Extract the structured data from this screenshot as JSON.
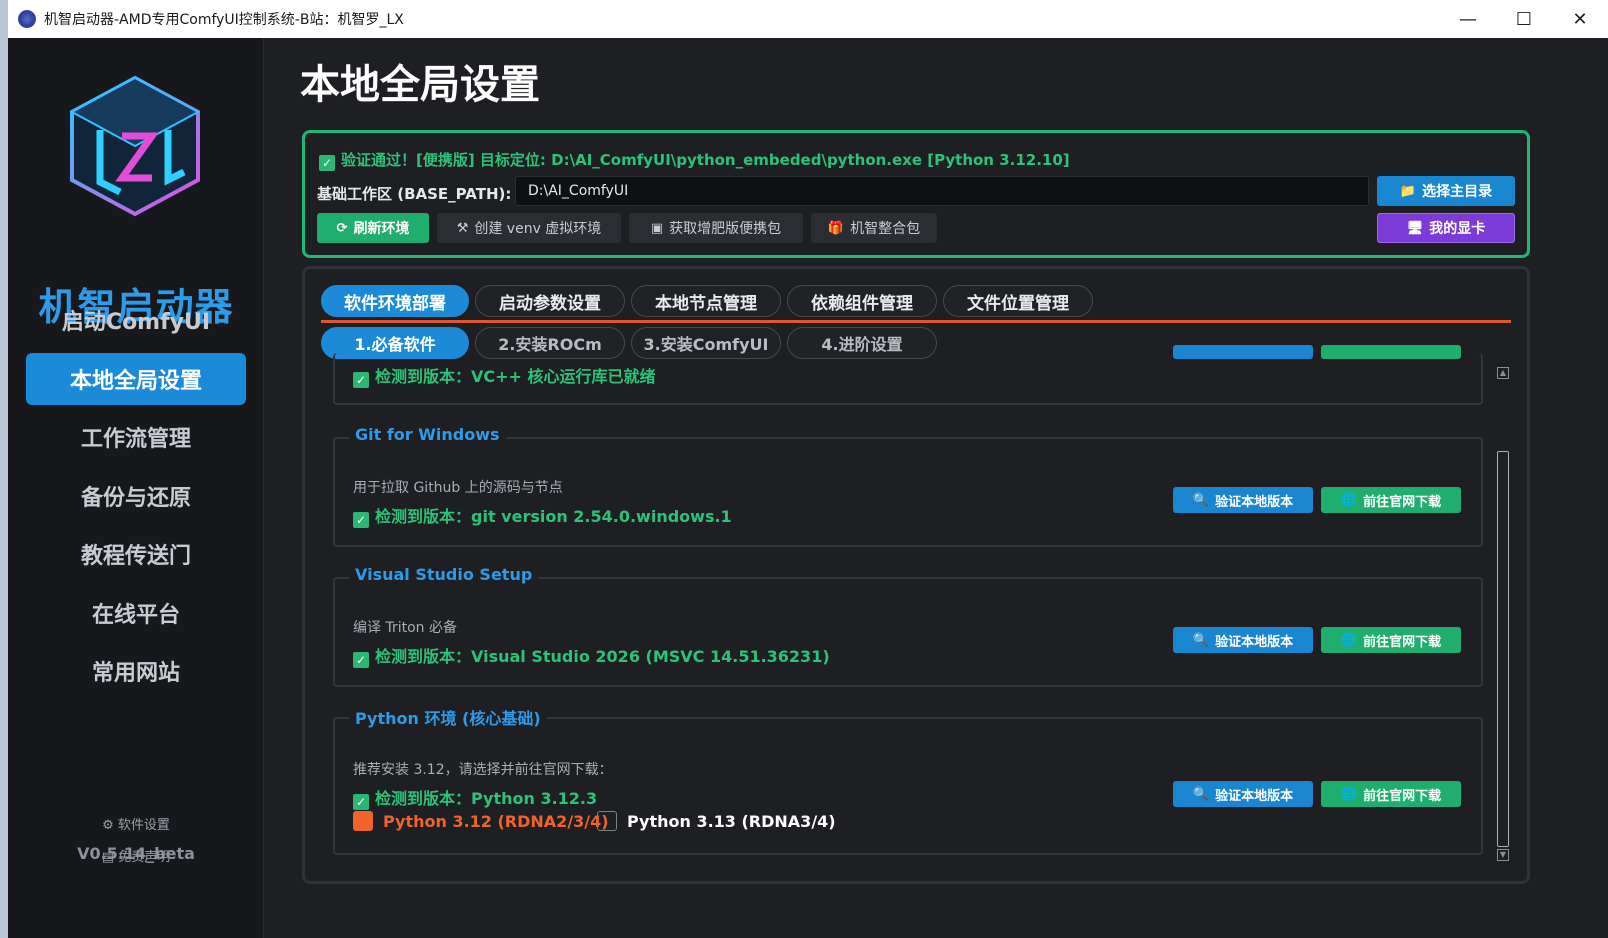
{
  "window": {
    "title": "机智启动器-AMD专用ComfyUI控制系统-B站：机智罗_LX",
    "min": "—",
    "max": "☐",
    "close": "✕"
  },
  "sidebar": {
    "brand": "机智启动器",
    "items": [
      {
        "label": "启动ComfyUI"
      },
      {
        "label": "本地全局设置"
      },
      {
        "label": "工作流管理"
      },
      {
        "label": "备份与还原"
      },
      {
        "label": "教程传送门"
      },
      {
        "label": "在线平台"
      },
      {
        "label": "常用网站"
      }
    ],
    "settings_label": "软件设置",
    "disclaimer_label": "免责声明",
    "version": "V0.5.14_beta"
  },
  "main": {
    "title": "本地全局设置"
  },
  "env": {
    "verify_text": "验证通过！[便携版] 目标定位: D:\\AI_ComfyUI\\python_embeded\\python.exe [Python 3.12.10]",
    "base_label": "基础工作区 (BASE_PATH):",
    "base_value": "D:\\AI_ComfyUI",
    "btn_choose": "选择主目录",
    "btn_gpu": "我的显卡",
    "btn_refresh": "刷新环境",
    "btn_venv": "创建 venv 虚拟环境",
    "btn_portable": "获取增肥版便携包",
    "btn_bundle": "机智整合包"
  },
  "tabs": [
    "软件环境部署",
    "启动参数设置",
    "本地节点管理",
    "依赖组件管理",
    "文件位置管理"
  ],
  "subtabs": [
    "1.必备软件",
    "2.安装ROCm",
    "3.安装ComfyUI",
    "4.进阶设置"
  ],
  "verify_btn": "验证本地版本",
  "download_btn": "前往官网下载",
  "groups": {
    "vcpp": {
      "detected": "检测到版本：VC++ 核心运行库已就绪"
    },
    "git": {
      "title": "Git for Windows",
      "desc": "用于拉取 Github 上的源码与节点",
      "detected": "检测到版本：git version 2.54.0.windows.1"
    },
    "vs": {
      "title": "Visual Studio Setup",
      "desc": "编译 Triton 必备",
      "detected": "检测到版本：Visual Studio 2026 (MSVC 14.51.36231)"
    },
    "python": {
      "title": "Python 环境 (核心基础)",
      "desc": "推荐安装 3.12，请选择并前往官网下载：",
      "detected": "检测到版本：Python 3.12.3",
      "opt1": "Python 3.12 (RDNA2/3/4)",
      "opt2": "Python 3.13 (RDNA3/4)"
    }
  },
  "colors": {
    "accent": "#1c8ad6",
    "success": "#2cc277",
    "warning": "#e2562a",
    "purple": "#7b3bd6"
  }
}
